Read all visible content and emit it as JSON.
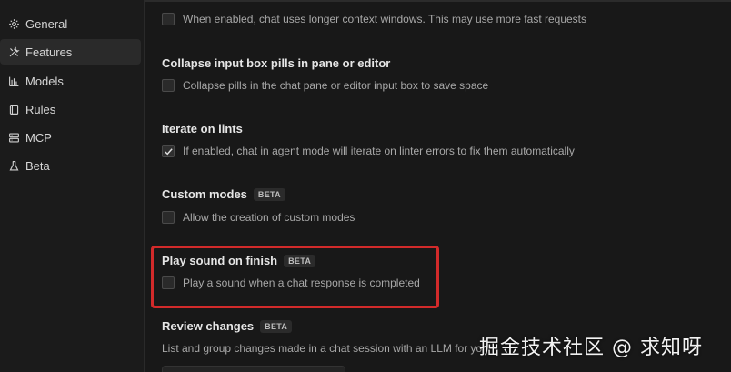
{
  "sidebar": {
    "items": [
      {
        "label": "General",
        "icon": "gear-icon"
      },
      {
        "label": "Features",
        "icon": "tools-icon"
      },
      {
        "label": "Models",
        "icon": "bar-chart-icon"
      },
      {
        "label": "Rules",
        "icon": "book-icon"
      },
      {
        "label": "MCP",
        "icon": "server-icon"
      },
      {
        "label": "Beta",
        "icon": "flask-icon"
      }
    ],
    "active": "Features"
  },
  "settings": {
    "long_context_desc": "When enabled, chat uses longer context windows. This may use more fast requests",
    "collapse_pills_title": "Collapse input box pills in pane or editor",
    "collapse_pills_desc": "Collapse pills in the chat pane or editor input box to save space",
    "iterate_lints_title": "Iterate on lints",
    "iterate_lints_desc": "If enabled, chat in agent mode will iterate on linter errors to fix them automatically",
    "custom_modes_title": "Custom modes",
    "custom_modes_badge": "BETA",
    "custom_modes_desc": "Allow the creation of custom modes",
    "play_sound_title": "Play sound on finish",
    "play_sound_badge": "BETA",
    "play_sound_desc": "Play a sound when a chat response is completed",
    "review_changes_title": "Review changes",
    "review_changes_badge": "BETA",
    "review_changes_desc": "List and group changes made in a chat session with an LLM for yo"
  },
  "checkbox_states": {
    "long_context": false,
    "collapse_pills": false,
    "iterate_lints": true,
    "custom_modes": false,
    "play_sound": false
  },
  "watermark": "掘金技术社区 @ 求知呀",
  "colors": {
    "highlight": "#d22a2a",
    "background": "#181818",
    "sidebar": "#1b1b1b"
  }
}
